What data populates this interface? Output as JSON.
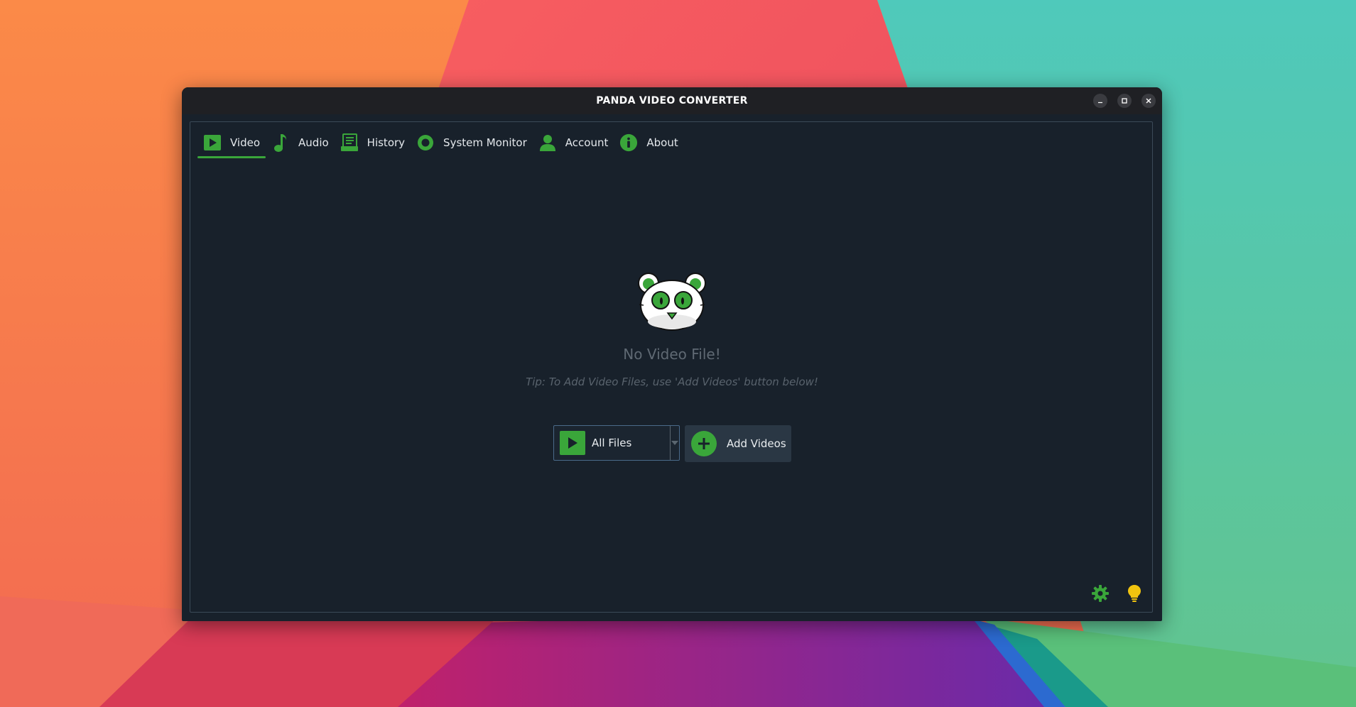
{
  "window": {
    "title": "PANDA VIDEO CONVERTER"
  },
  "tabs": [
    {
      "label": "Video",
      "icon": "play-icon",
      "active": true
    },
    {
      "label": "Audio",
      "icon": "music-note-icon",
      "active": false
    },
    {
      "label": "History",
      "icon": "history-icon",
      "active": false
    },
    {
      "label": "System Monitor",
      "icon": "monitor-icon",
      "active": false
    },
    {
      "label": "Account",
      "icon": "user-icon",
      "active": false
    },
    {
      "label": "About",
      "icon": "info-icon",
      "active": false
    }
  ],
  "empty_state": {
    "title": "No Video File!",
    "tip": "Tip: To Add Video Files, use 'Add Videos' button below!"
  },
  "file_filter": {
    "selected": "All Files"
  },
  "add_button": {
    "label": "Add Videos"
  },
  "colors": {
    "accent": "#3aa63a",
    "background": "#18212b",
    "titlebar": "#1f2024",
    "tip_bulb": "#f1c40f"
  }
}
